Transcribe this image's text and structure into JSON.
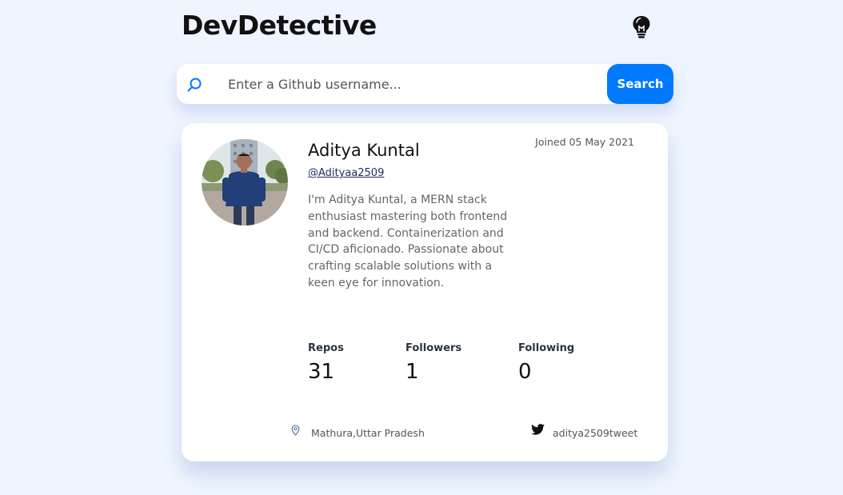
{
  "header": {
    "title": "DevDetective",
    "theme_icon": "lightbulb-icon"
  },
  "search": {
    "icon": "search-icon",
    "placeholder": "Enter a Github username...",
    "value": "",
    "button_label": "Search"
  },
  "profile": {
    "name": "Aditya Kuntal",
    "handle": "@Adityaa2509",
    "joined": "Joined 05 May 2021",
    "bio": "I'm Aditya Kuntal, a MERN stack enthusiast mastering both frontend and backend. Containerization and CI/CD aficionado. Passionate about crafting scalable solutions with a keen eye for innovation.",
    "stats": [
      {
        "label": "Repos",
        "value": "31"
      },
      {
        "label": "Followers",
        "value": "1"
      },
      {
        "label": "Following",
        "value": "0"
      }
    ],
    "location": "Mathura,Uttar Pradesh",
    "twitter": "aditya2509tweet"
  },
  "colors": {
    "background": "#eef5fe",
    "accent": "#0079ff",
    "card": "#ffffff"
  }
}
